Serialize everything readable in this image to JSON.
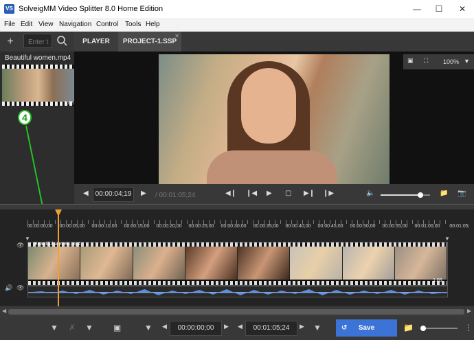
{
  "window": {
    "app_icon": "VS",
    "title": "SolveigMM Video Splitter 8.0 Home Edition",
    "minimize_icon": "minimize-icon",
    "maximize_icon": "maximize-icon",
    "close_icon": "close-icon"
  },
  "menu": [
    "File",
    "Edit",
    "View",
    "Navigation",
    "Control",
    "Tools",
    "Help"
  ],
  "toolbar": {
    "add_label": "+",
    "search_placeholder": "Enter t",
    "search_icon": "search-icon"
  },
  "tabs": [
    {
      "label": "PLAYER"
    },
    {
      "label": "PROJECT-1.SSP"
    }
  ],
  "media": {
    "file_name": "Beautiful women.mp4",
    "thumb_duration": "1:05",
    "marker_label": "4"
  },
  "video": {
    "zoom": "100%",
    "crop_icon": "crop-icon",
    "fullscreen_icon": "fullscreen-icon"
  },
  "player": {
    "current_time": "00:00:04;19",
    "total_time": "/ 00:01:05;24",
    "volume": 0.8
  },
  "timeline": {
    "tick_labels": [
      "00:00:00;00",
      "00:00:05;00",
      "00:00:10;00",
      "00:00:15;00",
      "00:00:20;00",
      "00:00:25;00",
      "00:00:30;00",
      "00:00:35;00",
      "00:00:40;00",
      "00:00:45;00",
      "00:00:50;00",
      "00:00:55;00",
      "00:01:00;00",
      "00:01:05;"
    ],
    "track_name": "Beautiful women.mp4",
    "track_duration": "1:05",
    "playhead_fraction": 0.072
  },
  "bottom": {
    "start_time": "00:00:00;00",
    "end_time": "00:01:05;24",
    "save_label": "Save",
    "zoom_level": 0
  },
  "colors": {
    "accent": "#3b73d6",
    "playhead": "#f0a030",
    "marker": "#25c125",
    "waveform": "#5b8fe0"
  }
}
